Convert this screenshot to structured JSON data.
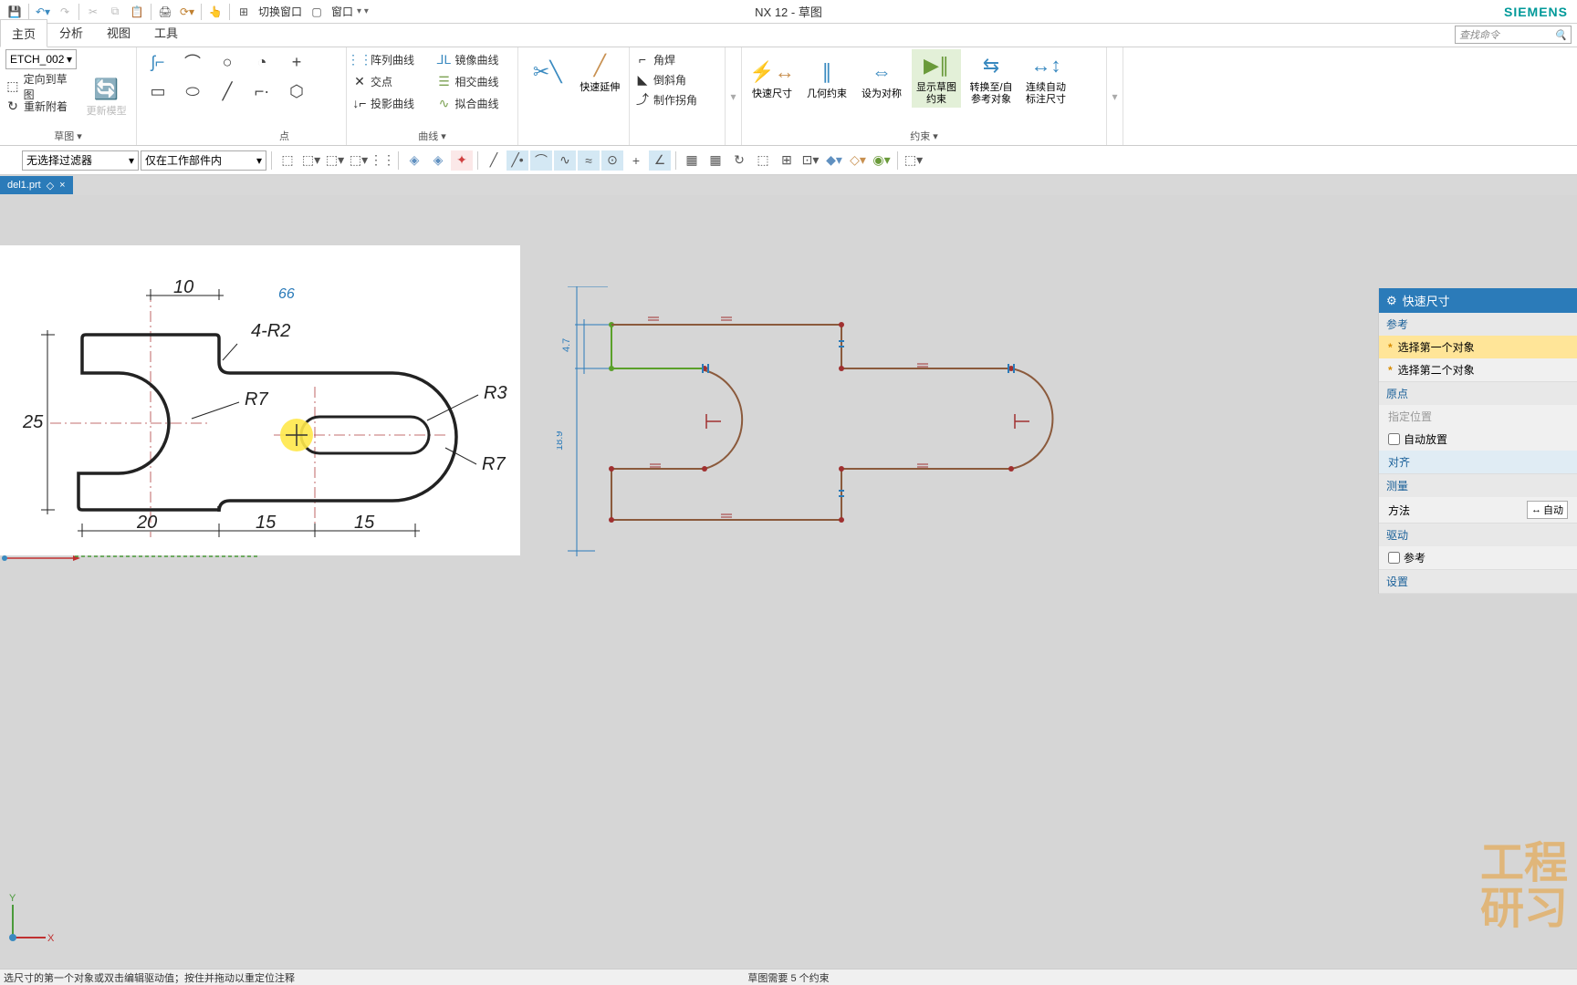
{
  "app": {
    "title": "NX 12 - 草图",
    "brand": "SIEMENS"
  },
  "qat": {
    "switch_window": "切换窗口",
    "window": "窗口"
  },
  "tabs": {
    "home": "主页",
    "analyze": "分析",
    "view": "视图",
    "tools": "工具"
  },
  "search": {
    "placeholder": "查找命令"
  },
  "ribbon": {
    "sketch_name": "ETCH_002",
    "orient": "定向到草图",
    "reattach": "重新附着",
    "update_model": "更新模型",
    "group_sketch": "草图",
    "point": "点",
    "pattern_curve": "阵列曲线",
    "mirror_curve": "镜像曲线",
    "intersection": "交点",
    "intersection_curve": "相交曲线",
    "project_curve": "投影曲线",
    "fit_curve": "拟合曲线",
    "group_curve": "曲线",
    "quick_extend": "快速延伸",
    "corner": "角焊",
    "chamfer": "倒斜角",
    "make_corner": "制作拐角",
    "rapid_dim": "快速尺寸",
    "geo_constraint": "几何约束",
    "make_symmetric": "设为对称",
    "show_sketch_constraints": "显示草图约束",
    "convert_ref": "转换至/自参考对象",
    "continuous_auto": "连续自动标注尺寸",
    "group_constraint": "约束"
  },
  "filters": {
    "no_filter": "无选择过滤器",
    "in_work_part": "仅在工作部件内"
  },
  "file_tab": "del1.prt",
  "drawing": {
    "d10": "10",
    "d66": "66",
    "r4_2": "4-R2",
    "r7a": "R7",
    "r3": "R3",
    "d25": "25",
    "r7b": "R7",
    "d20": "20",
    "d15a": "15",
    "d15b": "15",
    "dim47": "4.7",
    "dim189": "18.9"
  },
  "panel": {
    "title": "快速尺寸",
    "ref_section": "参考",
    "select_first": "选择第一个对象",
    "select_second": "选择第二个对象",
    "origin_section": "原点",
    "specify_loc": "指定位置",
    "auto_place": "自动放置",
    "align": "对齐",
    "measure_section": "测量",
    "method": "方法",
    "method_value": "自动",
    "drive_section": "驱动",
    "reference": "参考",
    "settings_section": "设置"
  },
  "status": {
    "left": "选尺寸的第一个对象或双击编辑驱动值；按住并拖动以重定位注释",
    "mid": "草图需要 5 个约束"
  },
  "watermark": {
    "l1": "工程",
    "l2": "研习"
  }
}
